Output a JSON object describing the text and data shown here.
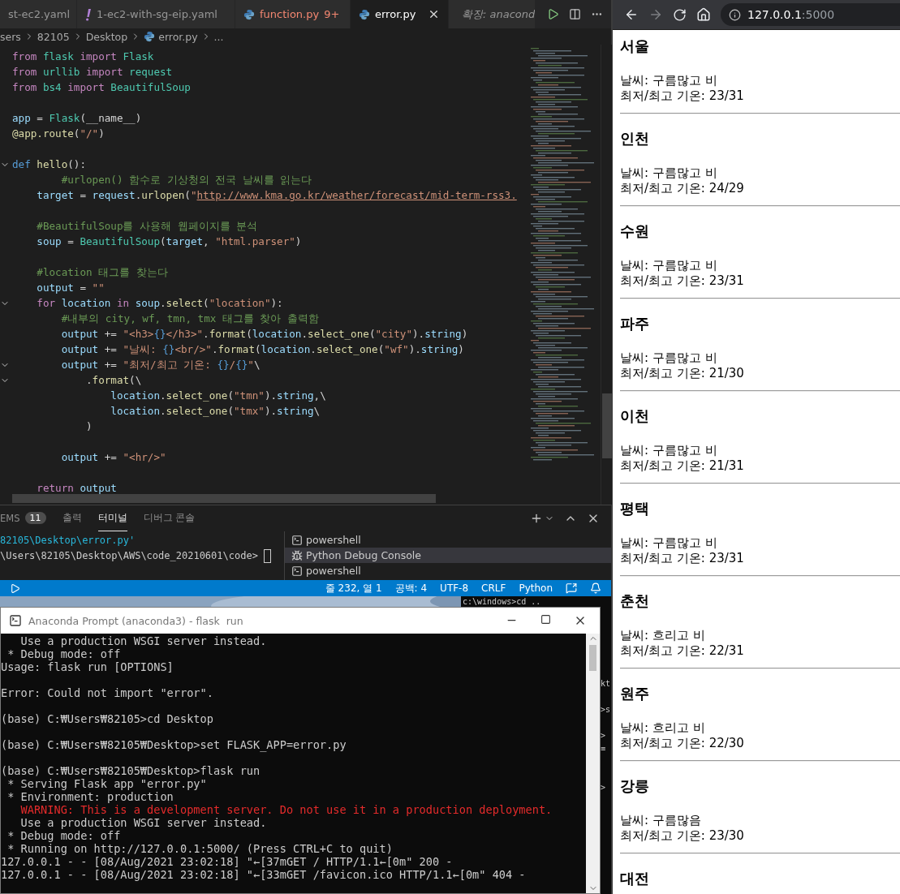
{
  "vscode": {
    "tabs": [
      {
        "label": "st-ec2.yaml",
        "kind": "plain",
        "selected": false,
        "errors": false
      },
      {
        "label": "1-ec2-with-sg-eip.yaml",
        "kind": "yaml",
        "selected": false,
        "errors": false
      },
      {
        "label": "function.py",
        "badge": "9+",
        "kind": "python",
        "selected": false,
        "errors": true
      },
      {
        "label": "error.py",
        "kind": "python",
        "selected": true,
        "errors": false
      },
      {
        "label": "확장: anacond",
        "kind": "preview",
        "selected": false,
        "errors": false
      }
    ],
    "breadcrumb": [
      {
        "label": "sers",
        "kind": "folder"
      },
      {
        "label": "82105",
        "kind": "folder"
      },
      {
        "label": "Desktop",
        "kind": "folder"
      },
      {
        "label": "error.py",
        "kind": "python"
      },
      {
        "label": "...",
        "kind": "folder"
      }
    ],
    "code_lines": [
      {
        "kind": "code",
        "fold": false,
        "tokens": [
          {
            "text": "from ",
            "kind": "kw"
          },
          {
            "text": "flask ",
            "kind": "cls"
          },
          {
            "text": "import ",
            "kind": "kw"
          },
          {
            "text": "Flask",
            "kind": "cls"
          }
        ]
      },
      {
        "kind": "code",
        "fold": false,
        "tokens": [
          {
            "text": "from ",
            "kind": "kw"
          },
          {
            "text": "urllib ",
            "kind": "cls"
          },
          {
            "text": "import ",
            "kind": "kw"
          },
          {
            "text": "request",
            "kind": "cls"
          }
        ]
      },
      {
        "kind": "code",
        "fold": false,
        "tokens": [
          {
            "text": "from ",
            "kind": "kw"
          },
          {
            "text": "bs4 ",
            "kind": "cls"
          },
          {
            "text": "import ",
            "kind": "kw"
          },
          {
            "text": "BeautifulSoup",
            "kind": "cls"
          }
        ]
      },
      {
        "kind": "blank"
      },
      {
        "kind": "code",
        "fold": false,
        "tokens": [
          {
            "text": "app",
            "kind": "var"
          },
          {
            "text": " = ",
            "kind": "p"
          },
          {
            "text": "Flask",
            "kind": "cls"
          },
          {
            "text": "(__name__)",
            "kind": "p"
          }
        ]
      },
      {
        "kind": "code",
        "fold": false,
        "tokens": [
          {
            "text": "@app.route",
            "kind": "fn"
          },
          {
            "text": "(",
            "kind": "p"
          },
          {
            "text": "\"/\"",
            "kind": "str"
          },
          {
            "text": ")",
            "kind": "p"
          }
        ]
      },
      {
        "kind": "blank"
      },
      {
        "kind": "code",
        "fold": true,
        "tokens": [
          {
            "text": "def ",
            "kind": "def"
          },
          {
            "text": "hello",
            "kind": "fn"
          },
          {
            "text": "():",
            "kind": "p"
          }
        ]
      },
      {
        "kind": "code",
        "fold": false,
        "tokens": [
          {
            "text": "        #urlopen() 함수로 기상청의 전국 날씨를 읽는다",
            "kind": "cmt"
          }
        ]
      },
      {
        "kind": "code",
        "fold": false,
        "tokens": [
          {
            "text": "    target",
            "kind": "var"
          },
          {
            "text": " = ",
            "kind": "p"
          },
          {
            "text": "request",
            "kind": "var"
          },
          {
            "text": ".",
            "kind": "p"
          },
          {
            "text": "urlopen",
            "kind": "fn"
          },
          {
            "text": "(",
            "kind": "p"
          },
          {
            "text": "\"",
            "kind": "str"
          },
          {
            "text": "http://www.kma.go.kr/weather/forecast/mid-term-rss3.",
            "kind": "link"
          }
        ]
      },
      {
        "kind": "blank"
      },
      {
        "kind": "code",
        "fold": false,
        "tokens": [
          {
            "text": "    #BeautifulSoup를 사용해 웹페이지를 분석",
            "kind": "cmt"
          }
        ]
      },
      {
        "kind": "code",
        "fold": false,
        "tokens": [
          {
            "text": "    soup",
            "kind": "var"
          },
          {
            "text": " = ",
            "kind": "p"
          },
          {
            "text": "BeautifulSoup",
            "kind": "cls"
          },
          {
            "text": "(",
            "kind": "p"
          },
          {
            "text": "target",
            "kind": "var"
          },
          {
            "text": ", ",
            "kind": "p"
          },
          {
            "text": "\"html.parser\"",
            "kind": "str"
          },
          {
            "text": ")",
            "kind": "p"
          }
        ]
      },
      {
        "kind": "blank"
      },
      {
        "kind": "code",
        "fold": false,
        "tokens": [
          {
            "text": "    #location 태그를 찾는다",
            "kind": "cmt"
          }
        ]
      },
      {
        "kind": "code",
        "fold": false,
        "tokens": [
          {
            "text": "    output",
            "kind": "var"
          },
          {
            "text": " = ",
            "kind": "p"
          },
          {
            "text": "\"\"",
            "kind": "str"
          }
        ]
      },
      {
        "kind": "code",
        "fold": true,
        "tokens": [
          {
            "text": "    for ",
            "kind": "kw"
          },
          {
            "text": "location ",
            "kind": "var"
          },
          {
            "text": "in ",
            "kind": "kw"
          },
          {
            "text": "soup",
            "kind": "var"
          },
          {
            "text": ".",
            "kind": "p"
          },
          {
            "text": "select",
            "kind": "fn"
          },
          {
            "text": "(",
            "kind": "p"
          },
          {
            "text": "\"location\"",
            "kind": "str"
          },
          {
            "text": "):",
            "kind": "p"
          }
        ]
      },
      {
        "kind": "code",
        "fold": false,
        "tokens": [
          {
            "text": "        #내부의 city, wf, tmn, tmx 태그를 찾아 출력함",
            "kind": "cmt"
          }
        ]
      },
      {
        "kind": "code",
        "fold": false,
        "tokens": [
          {
            "text": "        output",
            "kind": "var"
          },
          {
            "text": " += ",
            "kind": "p"
          },
          {
            "text": "\"<h3>",
            "kind": "str"
          },
          {
            "text": "{}",
            "kind": "esc"
          },
          {
            "text": "</h3>\"",
            "kind": "str"
          },
          {
            "text": ".",
            "kind": "p"
          },
          {
            "text": "format",
            "kind": "fn"
          },
          {
            "text": "(",
            "kind": "p"
          },
          {
            "text": "location",
            "kind": "var"
          },
          {
            "text": ".",
            "kind": "p"
          },
          {
            "text": "select_one",
            "kind": "fn"
          },
          {
            "text": "(",
            "kind": "p"
          },
          {
            "text": "\"city\"",
            "kind": "str"
          },
          {
            "text": ").",
            "kind": "p"
          },
          {
            "text": "string",
            "kind": "var"
          },
          {
            "text": ")",
            "kind": "p"
          }
        ]
      },
      {
        "kind": "code",
        "fold": false,
        "tokens": [
          {
            "text": "        output",
            "kind": "var"
          },
          {
            "text": " += ",
            "kind": "p"
          },
          {
            "text": "\"날씨: ",
            "kind": "str"
          },
          {
            "text": "{}",
            "kind": "esc"
          },
          {
            "text": "<br/>\"",
            "kind": "str"
          },
          {
            "text": ".",
            "kind": "p"
          },
          {
            "text": "format",
            "kind": "fn"
          },
          {
            "text": "(",
            "kind": "p"
          },
          {
            "text": "location",
            "kind": "var"
          },
          {
            "text": ".",
            "kind": "p"
          },
          {
            "text": "select_one",
            "kind": "fn"
          },
          {
            "text": "(",
            "kind": "p"
          },
          {
            "text": "\"wf\"",
            "kind": "str"
          },
          {
            "text": ").",
            "kind": "p"
          },
          {
            "text": "string",
            "kind": "var"
          },
          {
            "text": ")",
            "kind": "p"
          }
        ]
      },
      {
        "kind": "code",
        "fold": true,
        "tokens": [
          {
            "text": "        output",
            "kind": "var"
          },
          {
            "text": " += ",
            "kind": "p"
          },
          {
            "text": "\"최저/최고 기온: ",
            "kind": "str"
          },
          {
            "text": "{}",
            "kind": "esc"
          },
          {
            "text": "/",
            "kind": "str"
          },
          {
            "text": "{}",
            "kind": "esc"
          },
          {
            "text": "\"",
            "kind": "str"
          },
          {
            "text": "\\",
            "kind": "p"
          }
        ]
      },
      {
        "kind": "code",
        "fold": true,
        "tokens": [
          {
            "text": "            .",
            "kind": "p"
          },
          {
            "text": "format",
            "kind": "fn"
          },
          {
            "text": "(\\",
            "kind": "p"
          }
        ]
      },
      {
        "kind": "code",
        "fold": false,
        "tokens": [
          {
            "text": "                location",
            "kind": "var"
          },
          {
            "text": ".",
            "kind": "p"
          },
          {
            "text": "select_one",
            "kind": "fn"
          },
          {
            "text": "(",
            "kind": "p"
          },
          {
            "text": "\"tmn\"",
            "kind": "str"
          },
          {
            "text": ").",
            "kind": "p"
          },
          {
            "text": "string",
            "kind": "var"
          },
          {
            "text": ",\\",
            "kind": "p"
          }
        ]
      },
      {
        "kind": "code",
        "fold": false,
        "tokens": [
          {
            "text": "                location",
            "kind": "var"
          },
          {
            "text": ".",
            "kind": "p"
          },
          {
            "text": "select_one",
            "kind": "fn"
          },
          {
            "text": "(",
            "kind": "p"
          },
          {
            "text": "\"tmx\"",
            "kind": "str"
          },
          {
            "text": ").",
            "kind": "p"
          },
          {
            "text": "string",
            "kind": "var"
          },
          {
            "text": "\\",
            "kind": "p"
          }
        ]
      },
      {
        "kind": "code",
        "fold": false,
        "tokens": [
          {
            "text": "            )",
            "kind": "p"
          }
        ]
      },
      {
        "kind": "blank"
      },
      {
        "kind": "code",
        "fold": false,
        "tokens": [
          {
            "text": "        output",
            "kind": "var"
          },
          {
            "text": " += ",
            "kind": "p"
          },
          {
            "text": "\"<hr/>\"",
            "kind": "str"
          }
        ]
      },
      {
        "kind": "blank"
      },
      {
        "kind": "code",
        "fold": false,
        "tokens": [
          {
            "text": "    return ",
            "kind": "kw"
          },
          {
            "text": "output",
            "kind": "var"
          }
        ]
      }
    ],
    "panel": {
      "tabs": [
        {
          "label": "EMS",
          "badge": "11",
          "selected": false
        },
        {
          "label": "출력",
          "selected": false
        },
        {
          "label": "터미널",
          "selected": true
        },
        {
          "label": "디버그 콘솔",
          "selected": false
        }
      ],
      "terminal_lines": [
        {
          "text": "82105\\Desktop\\error.py'",
          "kind": "path"
        },
        {
          "text": "\\Users\\82105\\Desktop\\AWS\\code_20210601\\code>",
          "kind": "prompt"
        }
      ],
      "terminals": [
        {
          "label": "powershell",
          "kind": "shell",
          "selected": false
        },
        {
          "label": "Python Debug Console",
          "kind": "debug",
          "selected": true
        },
        {
          "label": "powershell",
          "kind": "shell",
          "selected": false
        }
      ]
    },
    "status_bar": {
      "items": [
        "줄 232, 열 1",
        "공백: 4",
        "UTF-8",
        "CRLF",
        "Python"
      ]
    }
  },
  "background_window": {
    "top_line": "c:\\windows>cd ..",
    "edge_lines": [
      {
        "kind": "text",
        "text": "kt"
      },
      {
        "kind": "blank"
      },
      {
        "kind": "text",
        "text": ">s"
      },
      {
        "kind": "blank"
      },
      {
        "kind": "text",
        "text": ">"
      },
      {
        "kind": "text",
        "text": "≡"
      },
      {
        "kind": "blank"
      },
      {
        "kind": "blank"
      },
      {
        "kind": "text",
        "text": ">"
      }
    ]
  },
  "anaconda_window": {
    "title": "Anaconda Prompt (anaconda3) - flask  run",
    "lines": [
      {
        "kind": "text",
        "text": "   Use a production WSGI server instead."
      },
      {
        "kind": "text",
        "text": " * Debug mode: off"
      },
      {
        "kind": "text",
        "text": "Usage: flask run [OPTIONS]"
      },
      {
        "kind": "blank"
      },
      {
        "kind": "text",
        "text": "Error: Could not import \"error\"."
      },
      {
        "kind": "blank"
      },
      {
        "kind": "text",
        "text": "(base) C:₩Users₩82105>cd Desktop"
      },
      {
        "kind": "blank"
      },
      {
        "kind": "text",
        "text": "(base) C:₩Users₩82105₩Desktop>set FLASK_APP=error.py"
      },
      {
        "kind": "blank"
      },
      {
        "kind": "text",
        "text": "(base) C:₩Users₩82105₩Desktop>flask run"
      },
      {
        "kind": "text",
        "text": " * Serving Flask app \"error.py\""
      },
      {
        "kind": "text",
        "text": " * Environment: production"
      },
      {
        "kind": "warning",
        "text": "   WARNING: This is a development server. Do not use it in a production deployment."
      },
      {
        "kind": "text",
        "text": "   Use a production WSGI server instead."
      },
      {
        "kind": "text",
        "text": " * Debug mode: off"
      },
      {
        "kind": "text",
        "text": " * Running on http://127.0.0.1:5000/ (Press CTRL+C to quit)"
      },
      {
        "kind": "text",
        "text": "127.0.0.1 - - [08/Aug/2021 23:02:18] \"←[37mGET / HTTP/1.1←[0m\" 200 -"
      },
      {
        "kind": "text",
        "text": "127.0.0.1 - - [08/Aug/2021 23:02:18] \"←[33mGET /favicon.ico HTTP/1.1←[0m\" 404 -"
      }
    ]
  },
  "browser": {
    "forward_enabled": false,
    "url_host": "127.0.0.1",
    "url_port": ":5000",
    "cities": [
      {
        "name": "서울",
        "weather": "날씨: 구름많고 비",
        "temps": "최저/최고 기온: 23/31"
      },
      {
        "name": "인천",
        "weather": "날씨: 구름많고 비",
        "temps": "최저/최고 기온: 24/29"
      },
      {
        "name": "수원",
        "weather": "날씨: 구름많고 비",
        "temps": "최저/최고 기온: 23/31"
      },
      {
        "name": "파주",
        "weather": "날씨: 구름많고 비",
        "temps": "최저/최고 기온: 21/30"
      },
      {
        "name": "이천",
        "weather": "날씨: 구름많고 비",
        "temps": "최저/최고 기온: 21/31"
      },
      {
        "name": "평택",
        "weather": "날씨: 구름많고 비",
        "temps": "최저/최고 기온: 23/31"
      },
      {
        "name": "춘천",
        "weather": "날씨: 흐리고 비",
        "temps": "최저/최고 기온: 22/31"
      },
      {
        "name": "원주",
        "weather": "날씨: 흐리고 비",
        "temps": "최저/최고 기온: 22/30"
      },
      {
        "name": "강릉",
        "weather": "날씨: 구름많음",
        "temps": "최저/최고 기온: 23/30"
      },
      {
        "name": "대전"
      }
    ]
  }
}
